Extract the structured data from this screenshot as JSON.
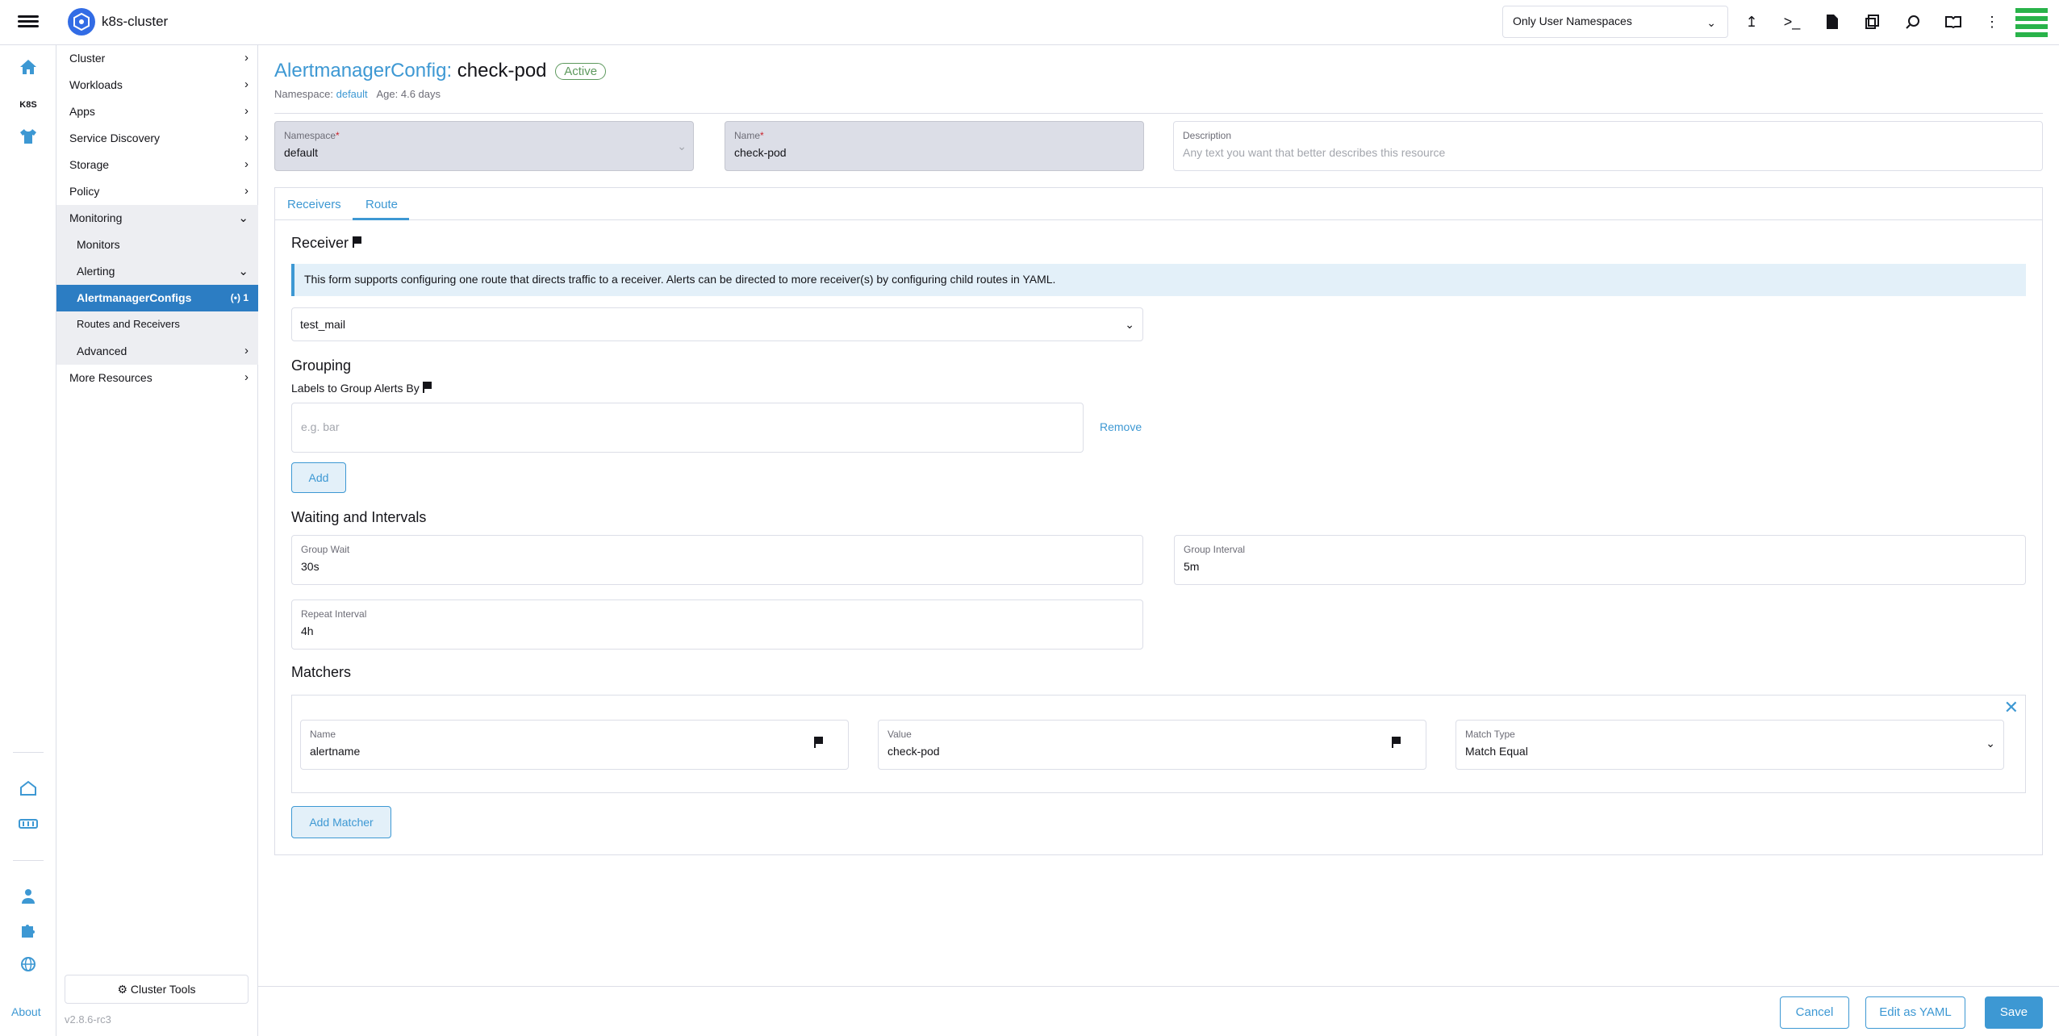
{
  "header": {
    "cluster_name": "k8s-cluster",
    "namespace_filter": "Only User Namespaces"
  },
  "rail": {
    "k8s_label": "K8S",
    "about_label": "About"
  },
  "sidenav": {
    "items": [
      {
        "label": "Cluster"
      },
      {
        "label": "Workloads"
      },
      {
        "label": "Apps"
      },
      {
        "label": "Service Discovery"
      },
      {
        "label": "Storage"
      },
      {
        "label": "Policy"
      },
      {
        "label": "Monitoring"
      },
      {
        "label": "Monitors"
      },
      {
        "label": "Alerting"
      },
      {
        "label": "AlertmanagerConfigs",
        "badge": "1"
      },
      {
        "label": "Routes and Receivers"
      },
      {
        "label": "Advanced"
      },
      {
        "label": "More Resources"
      }
    ],
    "tools_label": "Cluster Tools",
    "version": "v2.8.6-rc3"
  },
  "page": {
    "resource_type": "AlertmanagerConfig:",
    "resource_name": "check-pod",
    "state": "Active",
    "namespace_prefix": "Namespace:",
    "namespace_link": "default",
    "age": "Age: 4.6 days"
  },
  "form": {
    "namespace": {
      "label": "Namespace",
      "value": "default"
    },
    "name": {
      "label": "Name",
      "value": "check-pod"
    },
    "description": {
      "label": "Description",
      "placeholder": "Any text you want that better describes this resource"
    }
  },
  "tabs": [
    "Receivers",
    "Route"
  ],
  "route": {
    "receiver_title": "Receiver",
    "banner": "This form supports configuring one route that directs traffic to a receiver. Alerts can be directed to more receiver(s) by configuring child routes in YAML.",
    "receiver_value": "test_mail",
    "grouping_title": "Grouping",
    "group_labels_title": "Labels to Group Alerts By",
    "group_placeholder": "e.g. bar",
    "remove_label": "Remove",
    "add_label": "Add",
    "waiting_title": "Waiting and Intervals",
    "group_wait": {
      "label": "Group Wait",
      "value": "30s"
    },
    "group_interval": {
      "label": "Group Interval",
      "value": "5m"
    },
    "repeat_interval": {
      "label": "Repeat Interval",
      "value": "4h"
    },
    "matchers_title": "Matchers",
    "matcher": {
      "name_label": "Name",
      "name_value": "alertname",
      "value_label": "Value",
      "value_value": "check-pod",
      "type_label": "Match Type",
      "type_value": "Match Equal"
    },
    "add_matcher_label": "Add Matcher"
  },
  "footer": {
    "cancel": "Cancel",
    "edit_yaml": "Edit as YAML",
    "save": "Save"
  },
  "colors": {
    "accent": "#3d98d3",
    "active_nav": "#2c7dc3",
    "success": "#5d995d"
  }
}
